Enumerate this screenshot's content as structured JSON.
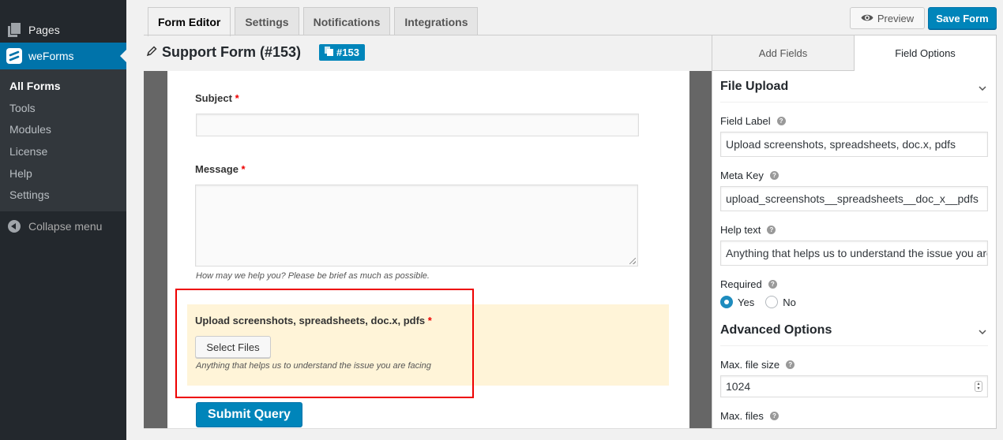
{
  "sidebar": {
    "pages_label": "Pages",
    "weforms_label": "weForms",
    "submenu": [
      {
        "label": "All Forms",
        "current": true
      },
      {
        "label": "Tools"
      },
      {
        "label": "Modules"
      },
      {
        "label": "License"
      },
      {
        "label": "Help"
      },
      {
        "label": "Settings"
      }
    ],
    "collapse_label": "Collapse menu"
  },
  "tabs": [
    {
      "label": "Form Editor",
      "active": true
    },
    {
      "label": "Settings"
    },
    {
      "label": "Notifications"
    },
    {
      "label": "Integrations"
    }
  ],
  "toolbar": {
    "preview_label": "Preview",
    "save_label": "Save Form"
  },
  "form": {
    "title": "Support Form (#153)",
    "id_badge": "#153",
    "fields": {
      "subject": {
        "label": "Subject",
        "required_mark": "*",
        "value": ""
      },
      "message": {
        "label": "Message",
        "required_mark": "*",
        "value": "",
        "help": "How may we help you? Please be brief as much as possible."
      },
      "upload": {
        "label": "Upload screenshots, spreadsheets, doc.x, pdfs",
        "required_mark": "*",
        "button": "Select Files",
        "help": "Anything that helps us to understand the issue you are facing"
      }
    },
    "submit_label": "Submit Query"
  },
  "panel": {
    "tabs": [
      {
        "label": "Add Fields"
      },
      {
        "label": "Field Options",
        "active": true
      }
    ],
    "section_title": "File Upload",
    "field_label": {
      "label": "Field Label",
      "value": "Upload screenshots, spreadsheets, doc.x, pdfs"
    },
    "meta_key": {
      "label": "Meta Key",
      "value": "upload_screenshots__spreadsheets__doc_x__pdfs"
    },
    "help_text": {
      "label": "Help text",
      "value": "Anything that helps us to understand the issue you are facing"
    },
    "required": {
      "label": "Required",
      "options": [
        "Yes",
        "No"
      ],
      "selected": "Yes"
    },
    "advanced_title": "Advanced Options",
    "max_file_size": {
      "label": "Max. file size",
      "value": "1024"
    },
    "max_files_label": "Max. files"
  },
  "colors": {
    "accent": "#0085ba",
    "sidebar_bg": "#23282d",
    "highlight_border": "#e00000",
    "upload_field_bg": "#fff4d8"
  }
}
